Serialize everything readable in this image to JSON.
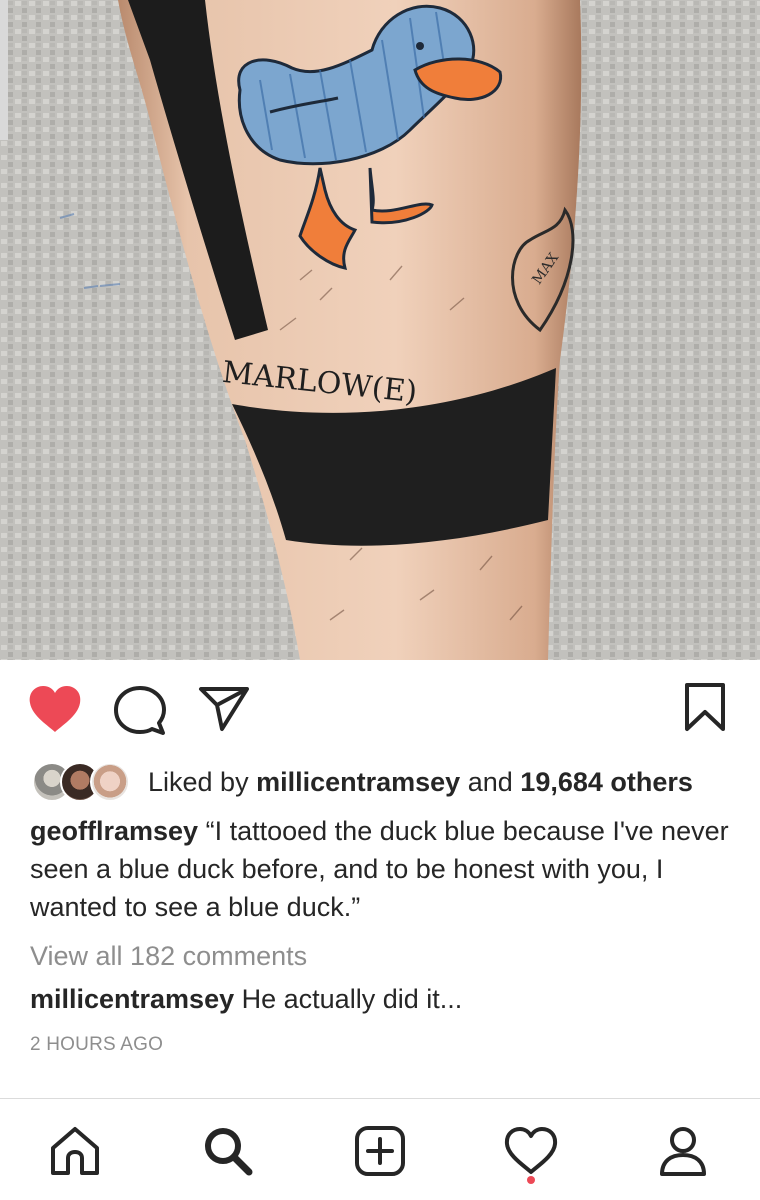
{
  "post": {
    "photo_icon": "tattoo-photo",
    "tattoo_text_lower": "MARLOW(E)",
    "tattoo_text_heart": "MAX"
  },
  "actions": {
    "like_icon": "heart-filled-icon",
    "like_color": "#ed4956",
    "comment_icon": "comment-icon",
    "share_icon": "paper-plane-icon",
    "save_icon": "bookmark-icon"
  },
  "likes": {
    "prefix": "Liked by",
    "user": "millicentramsey",
    "connector": "and",
    "count": "19,684 others"
  },
  "caption": {
    "username": "geofflramsey",
    "text": "“I tattooed the duck blue because I've never seen a blue duck before, and to be honest with you, I wanted to see a blue duck.”"
  },
  "comments": {
    "view_all": "View all 182 comments",
    "items": [
      {
        "username": "millicentramsey",
        "text": "He actually did it..."
      }
    ]
  },
  "timestamp": "2 HOURS AGO",
  "nav": {
    "items": [
      "home-icon",
      "search-icon",
      "add-post-icon",
      "activity-heart-icon",
      "profile-icon"
    ],
    "notification_color": "#ed4956"
  }
}
